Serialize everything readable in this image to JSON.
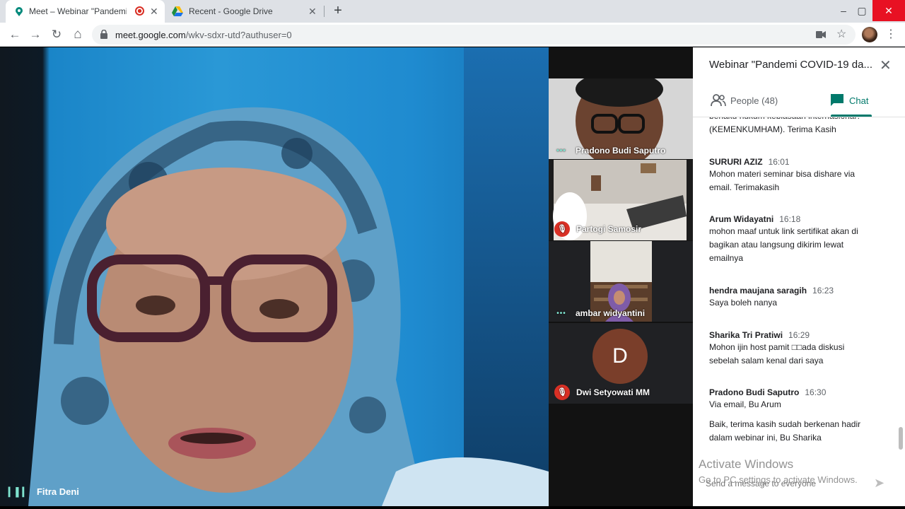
{
  "browser": {
    "tabs": [
      {
        "title": "Meet – Webinar \"Pandemi C",
        "active": true
      },
      {
        "title": "Recent - Google Drive",
        "active": false
      }
    ],
    "new_tab": "+",
    "window": {
      "minimize": "–",
      "maximize": "▢",
      "close": "✕"
    },
    "nav": {
      "back": "←",
      "forward": "→",
      "reload": "↻",
      "home": "⌂"
    },
    "url_host": "meet.google.com",
    "url_path": "/wkv-sdxr-utd?authuser=0",
    "star": "☆",
    "menu": "⋮"
  },
  "main_video": {
    "participant": "Fitra Deni",
    "indicator": "▎▌▎"
  },
  "thumbnails": [
    {
      "name": "Pradono Budi Saputro",
      "status": "speaking"
    },
    {
      "name": "Partogi Samosir",
      "status": "muted"
    },
    {
      "name": "ambar widyantini",
      "status": "speaking"
    },
    {
      "name": "Dwi Setyowati MM",
      "status": "muted",
      "initial": "D"
    }
  ],
  "panel": {
    "title": "Webinar \"Pandemi COVID-19 da...",
    "close": "✕",
    "people_tab": "People (48)",
    "chat_tab": "Chat",
    "messages": [
      {
        "text": "berlaku hukum kebiasaan internasional? (KEMENKUMHAM). Terima Kasih"
      },
      {
        "author": "SURURI AZIZ",
        "time": "16:01",
        "text": "Mohon materi seminar bisa dishare via email. Terimakasih"
      },
      {
        "author": "Arum Widayatni",
        "time": "16:18",
        "text": "mohon maaf untuk link sertifikat akan di bagikan atau langsung dikirim lewat emailnya"
      },
      {
        "author": "hendra maujana saragih",
        "time": "16:23",
        "text": "Saya boleh nanya"
      },
      {
        "author": "Sharika Tri Pratiwi",
        "time": "16:29",
        "text": "Mohon ijin host pamit □□ada diskusi sebelah salam kenal dari saya"
      },
      {
        "author": "Pradono Budi Saputro",
        "time": "16:30",
        "text": "Via email, Bu Arum"
      },
      {
        "text": "Baik, terima kasih sudah berkenan hadir dalam webinar ini, Bu Sharika"
      }
    ],
    "activate_line1": "Activate Windows",
    "activate_line2": "Go to PC settings to activate Windows.",
    "input_placeholder": "Send a message to everyone",
    "send": "➤"
  },
  "colors": {
    "accent": "#00796b",
    "mute": "#d93025",
    "avatar_d": "#7a3e2a"
  }
}
